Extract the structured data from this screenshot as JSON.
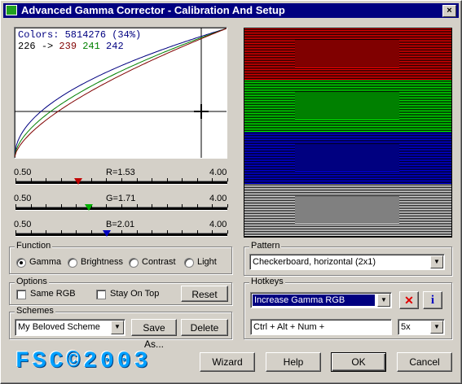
{
  "window": {
    "title": "Advanced Gamma Corrector - Calibration And Setup",
    "close_glyph": "×"
  },
  "graph": {
    "colors_text": "Colors: 5814276 (34%)",
    "input_value": "226",
    "arrow": "->",
    "out_r": "239",
    "out_g": "241",
    "out_b": "242"
  },
  "sliders": [
    {
      "name": "red",
      "min": "0.50",
      "max": "4.00",
      "label": "R=1.53",
      "value": 1.53,
      "color": "#c00000"
    },
    {
      "name": "green",
      "min": "0.50",
      "max": "4.00",
      "label": "G=1.71",
      "value": 1.71,
      "color": "#00b000"
    },
    {
      "name": "blue",
      "min": "0.50",
      "max": "4.00",
      "label": "B=2.01",
      "value": 2.01,
      "color": "#0000c0"
    }
  ],
  "function": {
    "title": "Function",
    "options": [
      "Gamma",
      "Brightness",
      "Contrast",
      "Light"
    ],
    "selected": "Gamma"
  },
  "options": {
    "title": "Options",
    "same_rgb": "Same RGB",
    "stay_on_top": "Stay On Top",
    "reset": "Reset"
  },
  "schemes": {
    "title": "Schemes",
    "selected": "My Beloved Scheme",
    "save_as": "Save As...",
    "delete": "Delete"
  },
  "pattern": {
    "title": "Pattern",
    "selected": "Checkerboard, horizontal (2x1)"
  },
  "hotkeys": {
    "title": "Hotkeys",
    "selected": "Increase Gamma RGB",
    "keys": "Ctrl + Alt + Num +",
    "step": "5x",
    "delete_glyph": "✕",
    "info_glyph": "i"
  },
  "footer": {
    "logo": "FSC©2003",
    "wizard": "Wizard",
    "help": "Help",
    "ok": "OK",
    "cancel": "Cancel"
  },
  "colors": {
    "red": "#800000",
    "green": "#008000",
    "blue": "#000080",
    "gray": "#808080",
    "highlight": "#000080"
  }
}
